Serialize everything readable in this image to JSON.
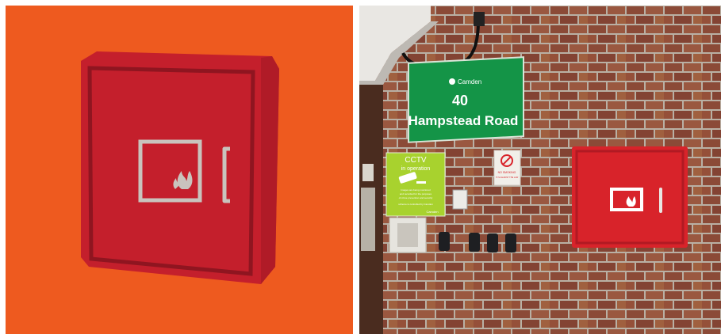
{
  "colors": {
    "orange_background": "#ee5a1f",
    "cabinet_red": "#c41f2c",
    "cabinet_dark": "#9e1722",
    "bracket_grey": "#c9c3bd",
    "sign_green": "#149447",
    "cctv_lime": "#a8d22e",
    "brick": "#8b4a37"
  },
  "icons": {
    "fire": "fire-icon",
    "camden_logo": "camden-logo",
    "camera": "camera-icon"
  },
  "sign": {
    "brand": "Camden",
    "number": "40",
    "street": "Hampstead Road"
  },
  "cctv": {
    "title": "CCTV",
    "subtitle": "in operation",
    "small_text_1": "Images are being monitored",
    "small_text_2": "and recorded for the purposes",
    "small_text_3": "of crime prevention and security",
    "small_text_4": "scheme is controlled by Camden",
    "brand": "Camden"
  },
  "no_smoking": {
    "text_1": "NO SMOKING",
    "text_2": "IT IS AGAINST THE LAW"
  }
}
